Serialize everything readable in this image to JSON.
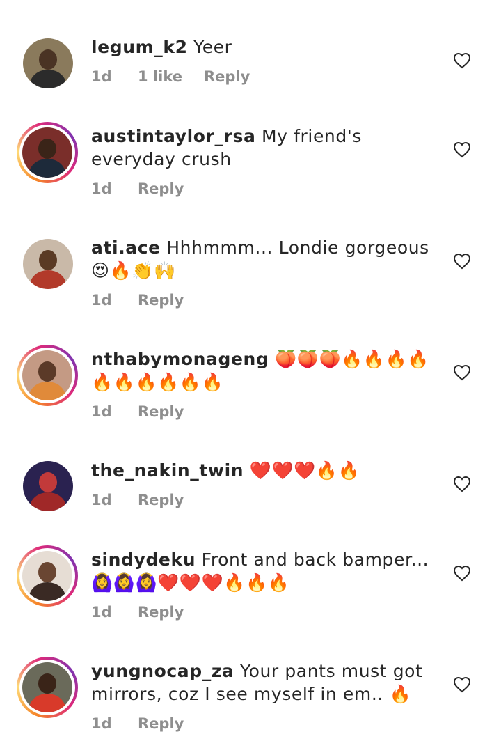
{
  "comments": [
    {
      "username": "legum_k2",
      "text": "Yeer",
      "time": "1d",
      "likes": "1 like",
      "reply": "Reply",
      "story_ring": false,
      "avatar_colors": {
        "bg": "#8a7a5c",
        "face": "#4a3324",
        "body": "#2b2b2b"
      }
    },
    {
      "username": "austintaylor_rsa",
      "text": "My friend's everyday crush",
      "time": "1d",
      "likes": "",
      "reply": "Reply",
      "story_ring": true,
      "avatar_colors": {
        "bg": "#7a2e2a",
        "face": "#3a2418",
        "body": "#1d2a3a"
      }
    },
    {
      "username": "ati.ace",
      "text": "Hhhmmm... Londie gorgeous 😍🔥👏🙌",
      "time": "1d",
      "likes": "",
      "reply": "Reply",
      "story_ring": false,
      "avatar_colors": {
        "bg": "#c9b9a8",
        "face": "#5a3a24",
        "body": "#b23a2a"
      }
    },
    {
      "username": "nthabymonageng",
      "text": "🍑🍑🍑🔥🔥🔥🔥🔥🔥🔥🔥🔥🔥",
      "time": "1d",
      "likes": "",
      "reply": "Reply",
      "story_ring": true,
      "avatar_colors": {
        "bg": "#c49a84",
        "face": "#5b3a28",
        "body": "#e08a3a"
      }
    },
    {
      "username": "the_nakin_twin",
      "text": "❤️❤️❤️🔥🔥",
      "time": "1d",
      "likes": "",
      "reply": "Reply",
      "story_ring": false,
      "avatar_colors": {
        "bg": "#2a2250",
        "face": "#c23a3a",
        "body": "#a02828"
      }
    },
    {
      "username": "sindydeku",
      "text": "Front and back bamper...🙆‍♀️🙆‍♀️🙆‍♀️❤️❤️❤️🔥🔥🔥",
      "time": "1d",
      "likes": "",
      "reply": "Reply",
      "story_ring": true,
      "avatar_colors": {
        "bg": "#e6ddd4",
        "face": "#6a4632",
        "body": "#3a2a24"
      }
    },
    {
      "username": "yungnocap_za",
      "text": "Your pants must got mirrors, coz I see myself in em.. 🔥",
      "time": "1d",
      "likes": "",
      "reply": "Reply",
      "story_ring": true,
      "avatar_colors": {
        "bg": "#6a6a5a",
        "face": "#3a2418",
        "body": "#d83a2a"
      }
    }
  ],
  "icons": {
    "like": "heart-outline-icon"
  }
}
